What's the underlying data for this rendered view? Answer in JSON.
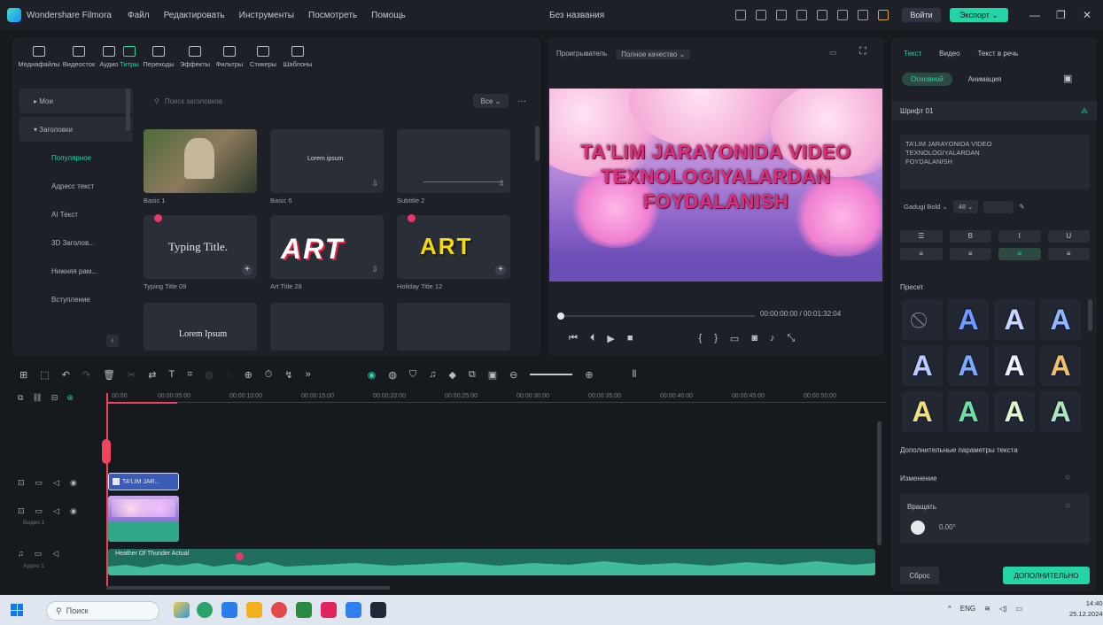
{
  "titlebar": {
    "app_name": "Wondershare Filmora",
    "menu": [
      "Файл",
      "Редактировать",
      "Инструменты",
      "Посмотреть",
      "Помощь"
    ],
    "project_name": "Без названия",
    "login_label": "Войти",
    "export_label": "Экспорт ⌄"
  },
  "library": {
    "tabs": [
      "Медиафайлы",
      "Видеосток",
      "Аудио",
      "Титры",
      "Переходы",
      "Эффекты",
      "Фильтры",
      "Стикеры",
      "Шаблоны"
    ],
    "active_tab": "Титры",
    "sidebar": [
      "Мои",
      "Заголовки",
      "Популярное",
      "Адресс текст",
      "AI Текст",
      "3D Заголов...",
      "Нижняя рам...",
      "Вступление"
    ],
    "search_placeholder": "Поиск заголовков",
    "filter_label": "Все ⌄",
    "cards": [
      {
        "label": "Basic 1"
      },
      {
        "label": "Basic 6",
        "inner": "Lorem ipsum"
      },
      {
        "label": "Subtitle 2"
      },
      {
        "label": "Typing Title 09",
        "inner": "Typing Title."
      },
      {
        "label": "Art Title 28",
        "inner": "ART"
      },
      {
        "label": "Holiday Title 12",
        "inner": "ART"
      },
      {
        "label": "",
        "inner": "Lorem Ipsum"
      },
      {
        "label": ""
      },
      {
        "label": ""
      }
    ]
  },
  "player": {
    "label": "Проигрыватель",
    "quality": "Полное качество ⌄",
    "video_title_lines": [
      "TA'LIM JARAYONIDA VIDEO",
      "TEXNOLOGIYALARDAN",
      "FOYDALANISH"
    ],
    "timecode": "00:00:00:00   /  00:01:32:04"
  },
  "properties": {
    "tabs": [
      "Текст",
      "Видео",
      "Текст в речь"
    ],
    "subtabs": [
      "Основной",
      "Анимация"
    ],
    "section_title": "Шрифт 01",
    "text_value": "TA'LIM JARAYONIDA VIDEO\nTEXNOLOGIYALARDAN\nFOYDALANISH",
    "font": "Gadugi Bold ⌄",
    "size": "48 ⌄",
    "presets_label": "Пресет",
    "advanced_label": "Дополнительные параметры текста",
    "transform_label": "Изменение",
    "rotate_label": "Вращать",
    "rotate_value": "0.00°",
    "reset_label": "Сброс",
    "more_label": "ДОПОЛНИТЕЛЬНО"
  },
  "timeline": {
    "ruler": [
      "00:00",
      "00:00:05:00",
      "00:00:10:00",
      "00:00:15:00",
      "00:00:20:00",
      "00:00:25:00",
      "00:00:30:00",
      "00:00:35:00",
      "00:00:40:00",
      "00:00:45:00",
      "00:00:50:00"
    ],
    "title_clip": "TA'LIM JAR...",
    "video_track_label": "Видео 1",
    "audio_track_label": "Аудио 1",
    "audio_clip": "Heather Of Thunder Actual"
  },
  "taskbar": {
    "search_label": "Поиск",
    "tray_lang": "ENG",
    "time": "14:40",
    "date": "25.12.2024"
  },
  "colors": {
    "accent": "#25d7a8",
    "playhead": "#f0445c",
    "title_text": "#d8307a"
  }
}
